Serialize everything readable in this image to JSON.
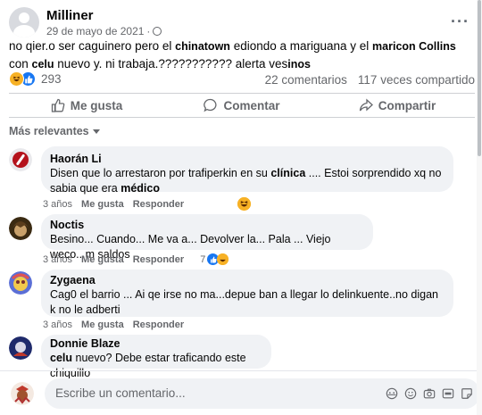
{
  "post": {
    "author": "Milliner",
    "date": "29 de mayo de 2021",
    "text_parts": [
      "no qier.o ser caguinero pero el ",
      "chinatown",
      " ediondo a mariguana y el ",
      "maricon Collins",
      " con ",
      "celu",
      "  nuevo y. ni trabaja.??????????? alerta ves",
      "inos"
    ],
    "reaction_count": "293",
    "comments_count": "22 comentarios",
    "shares_count": "117 veces compartido"
  },
  "actions": {
    "like": "Me gusta",
    "comment": "Comentar",
    "share": "Compartir"
  },
  "sort_label": "Más relevantes",
  "comments": [
    {
      "name": "Haorán Li",
      "text_parts": [
        "Disen que lo arrestaron por trafiperkin en su ",
        "clínica",
        "            .... Estoi sorprendido xq no sabia que era ",
        "médico"
      ],
      "time": "3 años",
      "like": "Me gusta",
      "reply": "Responder",
      "reaction_count": ""
    },
    {
      "name": "Noctis",
      "text": "Besino... Cuando... Me va a... Devolver la... Pala ... Viejo weco...m saldos",
      "time": "3 años",
      "like": "Me gusta",
      "reply": "Responder",
      "reaction_count": "7"
    },
    {
      "name": "Zygaena",
      "text": "Cag0 el barrio ... Ai qe irse no ma...depue ban a llegar lo delinkuente..no digan k no le adberti",
      "time": "3 años",
      "like": "Me gusta",
      "reply": "Responder",
      "reaction_count": ""
    },
    {
      "name": "Donnie Blaze",
      "text_parts": [
        " ",
        "celu",
        " nuevo? Debe estar traficando este chiquillo"
      ]
    }
  ],
  "composer": {
    "placeholder": "Escribe un comentario..."
  },
  "colors": {
    "like_blue": "#1877f2",
    "haha_yellow": "#f7b125",
    "muted": "#65676b",
    "bubble": "#f0f2f5"
  }
}
